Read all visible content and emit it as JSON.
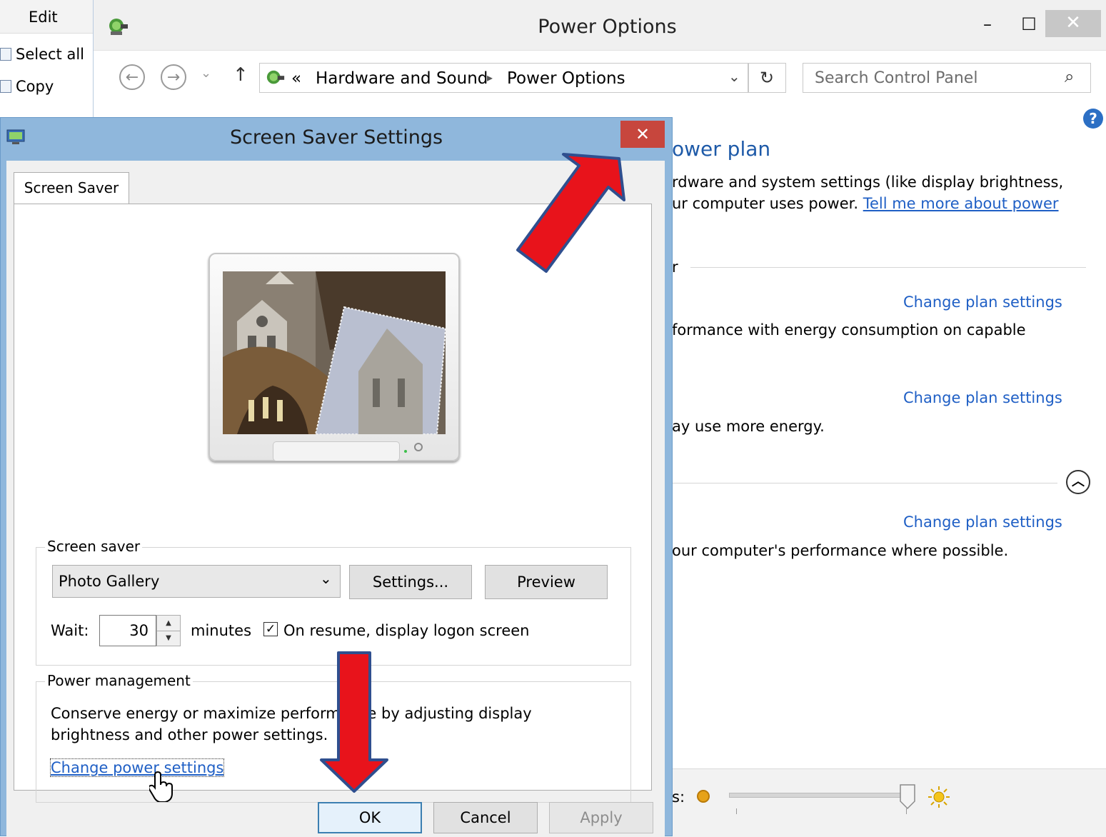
{
  "background_app": {
    "edit_label": "Edit",
    "select_all_label": "Select all",
    "copy_label": "Copy"
  },
  "power_options": {
    "title": "Power Options",
    "window_controls": {
      "minimize": "–",
      "maximize": "☐",
      "close": "✕"
    },
    "nav": {
      "back": "←",
      "forward": "→",
      "dropdown": "⌄",
      "up": "↑",
      "breadcrumb_prefix": "«",
      "breadcrumb": [
        "Hardware and Sound",
        "Power Options"
      ],
      "breadcrumb_sep": "▸",
      "addr_dropdown": "⌄",
      "refresh": "↻",
      "search_placeholder": "Search Control Panel",
      "search_icon": "⌕"
    },
    "help_icon": "?",
    "heading_partial": "ower plan",
    "intro_line1": "rdware and system settings (like display brightness,",
    "intro_line2_text": "ur computer uses power. ",
    "intro_link": "Tell me more about power",
    "section_letter": "r",
    "plans": [
      {
        "link": "Change plan settings",
        "desc": "formance with energy consumption on capable"
      },
      {
        "link": "Change plan settings",
        "desc": "ay use more energy."
      },
      {
        "link": "Change plan settings",
        "desc": "our computer's performance where possible."
      }
    ],
    "collapse_icon": "︿",
    "brightness_label": "s:"
  },
  "screen_saver_dialog": {
    "title": "Screen Saver Settings",
    "close": "✕",
    "tab_label": "Screen Saver",
    "screen_saver_group": {
      "legend": "Screen saver",
      "selected": "Photo Gallery",
      "select_arrow": "⌄",
      "settings_button": "Settings...",
      "preview_button": "Preview",
      "wait_label": "Wait:",
      "wait_value": "30",
      "spin_up": "▲",
      "spin_down": "▼",
      "minutes_label": "minutes",
      "resume_checked": "✓",
      "resume_label": "On resume, display logon screen"
    },
    "power_group": {
      "legend": "Power management",
      "desc_line1": "Conserve energy or maximize performance by adjusting display",
      "desc_line2": "brightness and other power settings.",
      "link": "Change power settings"
    },
    "buttons": {
      "ok": "OK",
      "cancel": "Cancel",
      "apply": "Apply"
    }
  },
  "annotations": {
    "arrow_color": "#e8131b",
    "arrow_outline": "#2f4f8f"
  }
}
